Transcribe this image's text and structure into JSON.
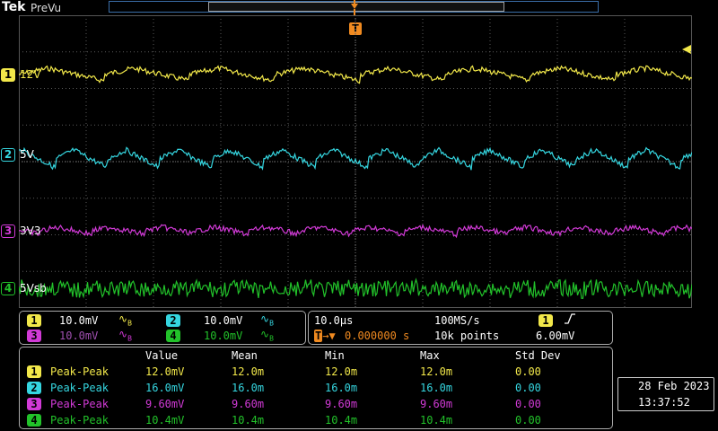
{
  "header": {
    "brand": "Tek",
    "mode": "PreVu",
    "trigger_marker": "T"
  },
  "channels": [
    {
      "num": "1",
      "label": "12V",
      "color": "#f2e84a"
    },
    {
      "num": "2",
      "label": "5V",
      "color": "#35d6e0"
    },
    {
      "num": "3",
      "label": "3V3",
      "color": "#d13ad6"
    },
    {
      "num": "4",
      "label": "5Vsb",
      "color": "#22c22a"
    }
  ],
  "settings": {
    "ch1_scale": "10.0mV",
    "ch2_scale": "10.0mV",
    "ch3_scale": "10.0mV",
    "ch4_scale": "10.0mV",
    "ch_suffix": "B",
    "timebase": "10.0µs",
    "sample_rate": "100MS/s",
    "trigger_delay": "0.000000 s",
    "record_length": "10k points",
    "trigger_source": "1",
    "trigger_level": "6.00mV"
  },
  "measurements": {
    "headers": [
      "Value",
      "Mean",
      "Min",
      "Max",
      "Std Dev"
    ],
    "rows": [
      {
        "ch": "1",
        "type": "Peak-Peak",
        "value": "12.0mV",
        "mean": "12.0m",
        "min": "12.0m",
        "max": "12.0m",
        "std": "0.00"
      },
      {
        "ch": "2",
        "type": "Peak-Peak",
        "value": "16.0mV",
        "mean": "16.0m",
        "min": "16.0m",
        "max": "16.0m",
        "std": "0.00"
      },
      {
        "ch": "3",
        "type": "Peak-Peak",
        "value": "9.60mV",
        "mean": "9.60m",
        "min": "9.60m",
        "max": "9.60m",
        "std": "0.00"
      },
      {
        "ch": "4",
        "type": "Peak-Peak",
        "value": "10.4mV",
        "mean": "10.4m",
        "min": "10.4m",
        "max": "10.4m",
        "std": "0.00"
      }
    ]
  },
  "datetime": {
    "date": "28 Feb  2023",
    "time": "13:37:52"
  },
  "colors": {
    "grid": "#5a5a5a",
    "accent_orange": "#f08a20"
  }
}
